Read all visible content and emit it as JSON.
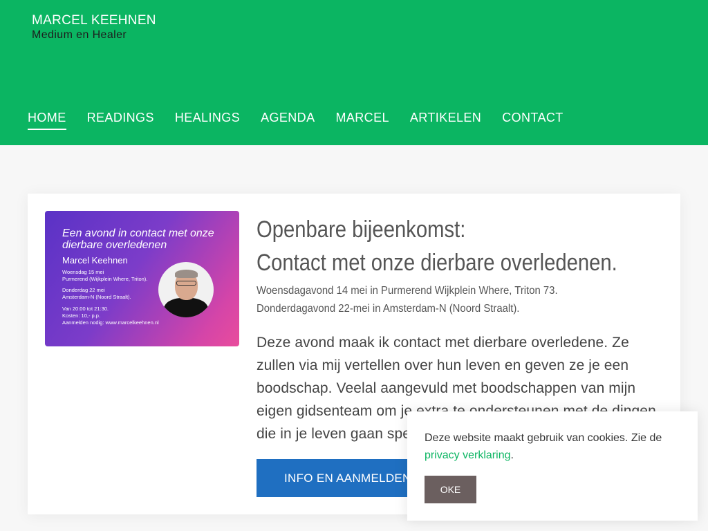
{
  "site": {
    "name": "MARCEL KEEHNEN",
    "tagline": "Medium en Healer"
  },
  "nav": {
    "items": [
      "HOME",
      "READINGS",
      "HEALINGS",
      "AGENDA",
      "MARCEL",
      "ARTIKELEN",
      "CONTACT"
    ],
    "active": "HOME"
  },
  "event": {
    "image": {
      "title": "Een avond in contact met onze dierbare overledenen",
      "name": "Marcel Keehnen",
      "line1": "Woensdag 15 mei",
      "line2": "Purmerend (Wijkplein Where, Triton).",
      "line3": "Donderdag 22 mei",
      "line4": "Amsterdam-N (Noord Straalt).",
      "line5": "Van 20:00 tot 21:30.",
      "line6": "Kosten: 10,- p.p.",
      "line7": "Aanmelden nodig: www.marcelkeehnen.nl"
    },
    "heading_line1": "Openbare bijeenkomst:",
    "heading_line2": "Contact met onze dierbare overledenen.",
    "date1": "Woensdagavond 14 mei in Purmerend Wijkplein Where, Triton 73.",
    "date2": "Donderdagavond 22-mei in Amsterdam-N (Noord Straalt).",
    "description": "Deze avond maak ik contact met dierbare overledene. Ze zullen via mij vertellen over hun leven en geven ze je een boodschap. Veelal aangevuld met boodschappen van mijn eigen gidsenteam om je extra te ondersteunen met de dingen die in je leven gaan spelen.",
    "button_label": "INFO EN AANMELDEN"
  },
  "cookie": {
    "text": "Deze website maakt gebruik van cookies. Zie de",
    "link_text": "privacy verklaring",
    "after_link": ".",
    "button_label": "OKE"
  },
  "colors": {
    "header_green": "#0bb562",
    "button_blue": "#1f6fc1",
    "cookie_button": "#6b5f5f"
  }
}
